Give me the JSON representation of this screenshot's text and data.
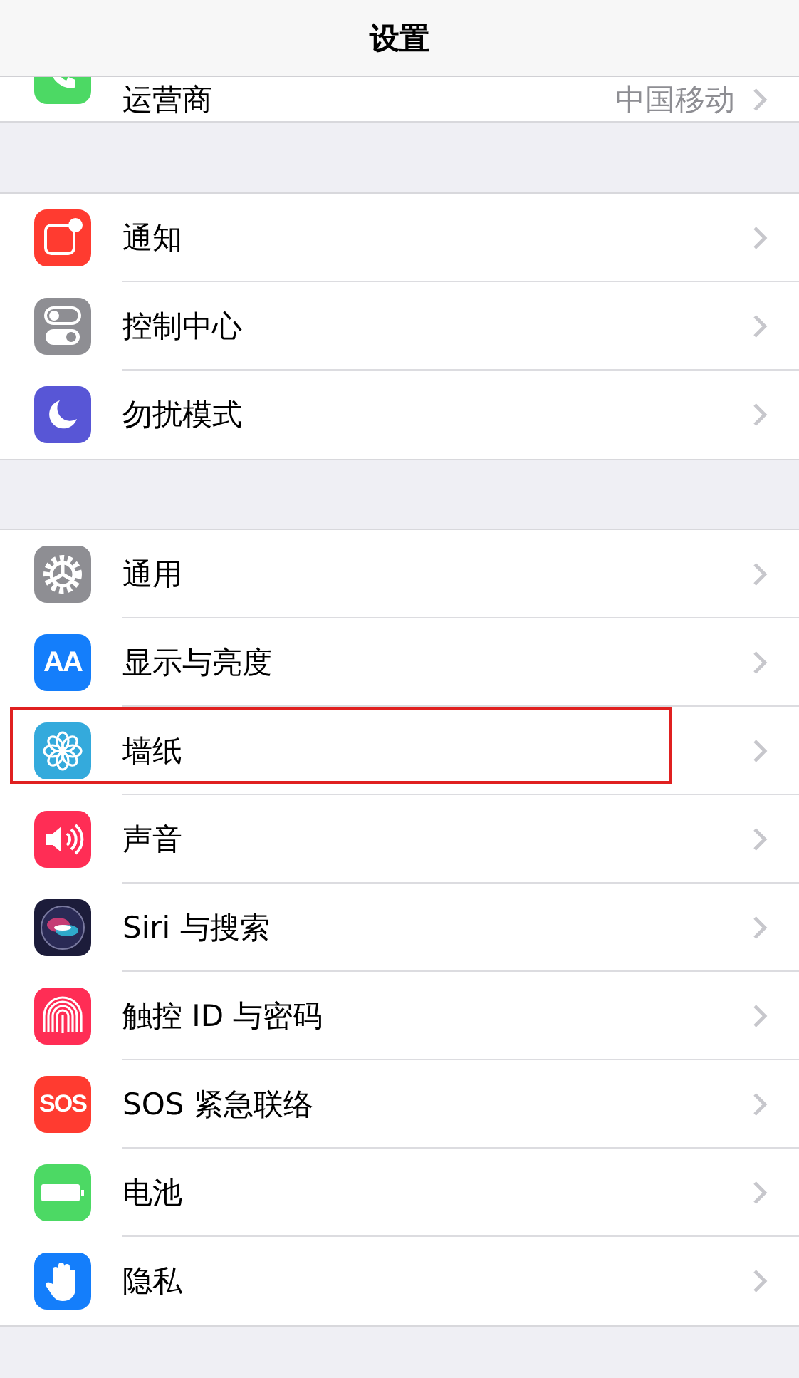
{
  "title": "设置",
  "groups": [
    {
      "cut_top": true,
      "items": [
        {
          "kind": "phone",
          "label": "运营商",
          "value": "中国移动",
          "highlighted": false
        }
      ]
    },
    {
      "items": [
        {
          "kind": "notifications",
          "label": "通知",
          "highlighted": false
        },
        {
          "kind": "control",
          "label": "控制中心",
          "highlighted": false
        },
        {
          "kind": "moon",
          "label": "勿扰模式",
          "highlighted": false
        }
      ]
    },
    {
      "items": [
        {
          "kind": "gear",
          "label": "通用",
          "highlighted": false
        },
        {
          "kind": "display",
          "label": "显示与亮度",
          "icon_text": "AA",
          "highlighted": false
        },
        {
          "kind": "flower",
          "label": "墙纸",
          "highlighted": true
        },
        {
          "kind": "sound",
          "label": "声音",
          "highlighted": false
        },
        {
          "kind": "siri",
          "label": "Siri 与搜索",
          "highlighted": false
        },
        {
          "kind": "fingerprint",
          "label": "触控 ID 与密码",
          "highlighted": false
        },
        {
          "kind": "sos",
          "label": "SOS 紧急联络",
          "icon_text": "SOS",
          "highlighted": false
        },
        {
          "kind": "battery",
          "label": "电池",
          "highlighted": false
        },
        {
          "kind": "hand",
          "label": "隐私",
          "highlighted": false
        }
      ]
    }
  ]
}
